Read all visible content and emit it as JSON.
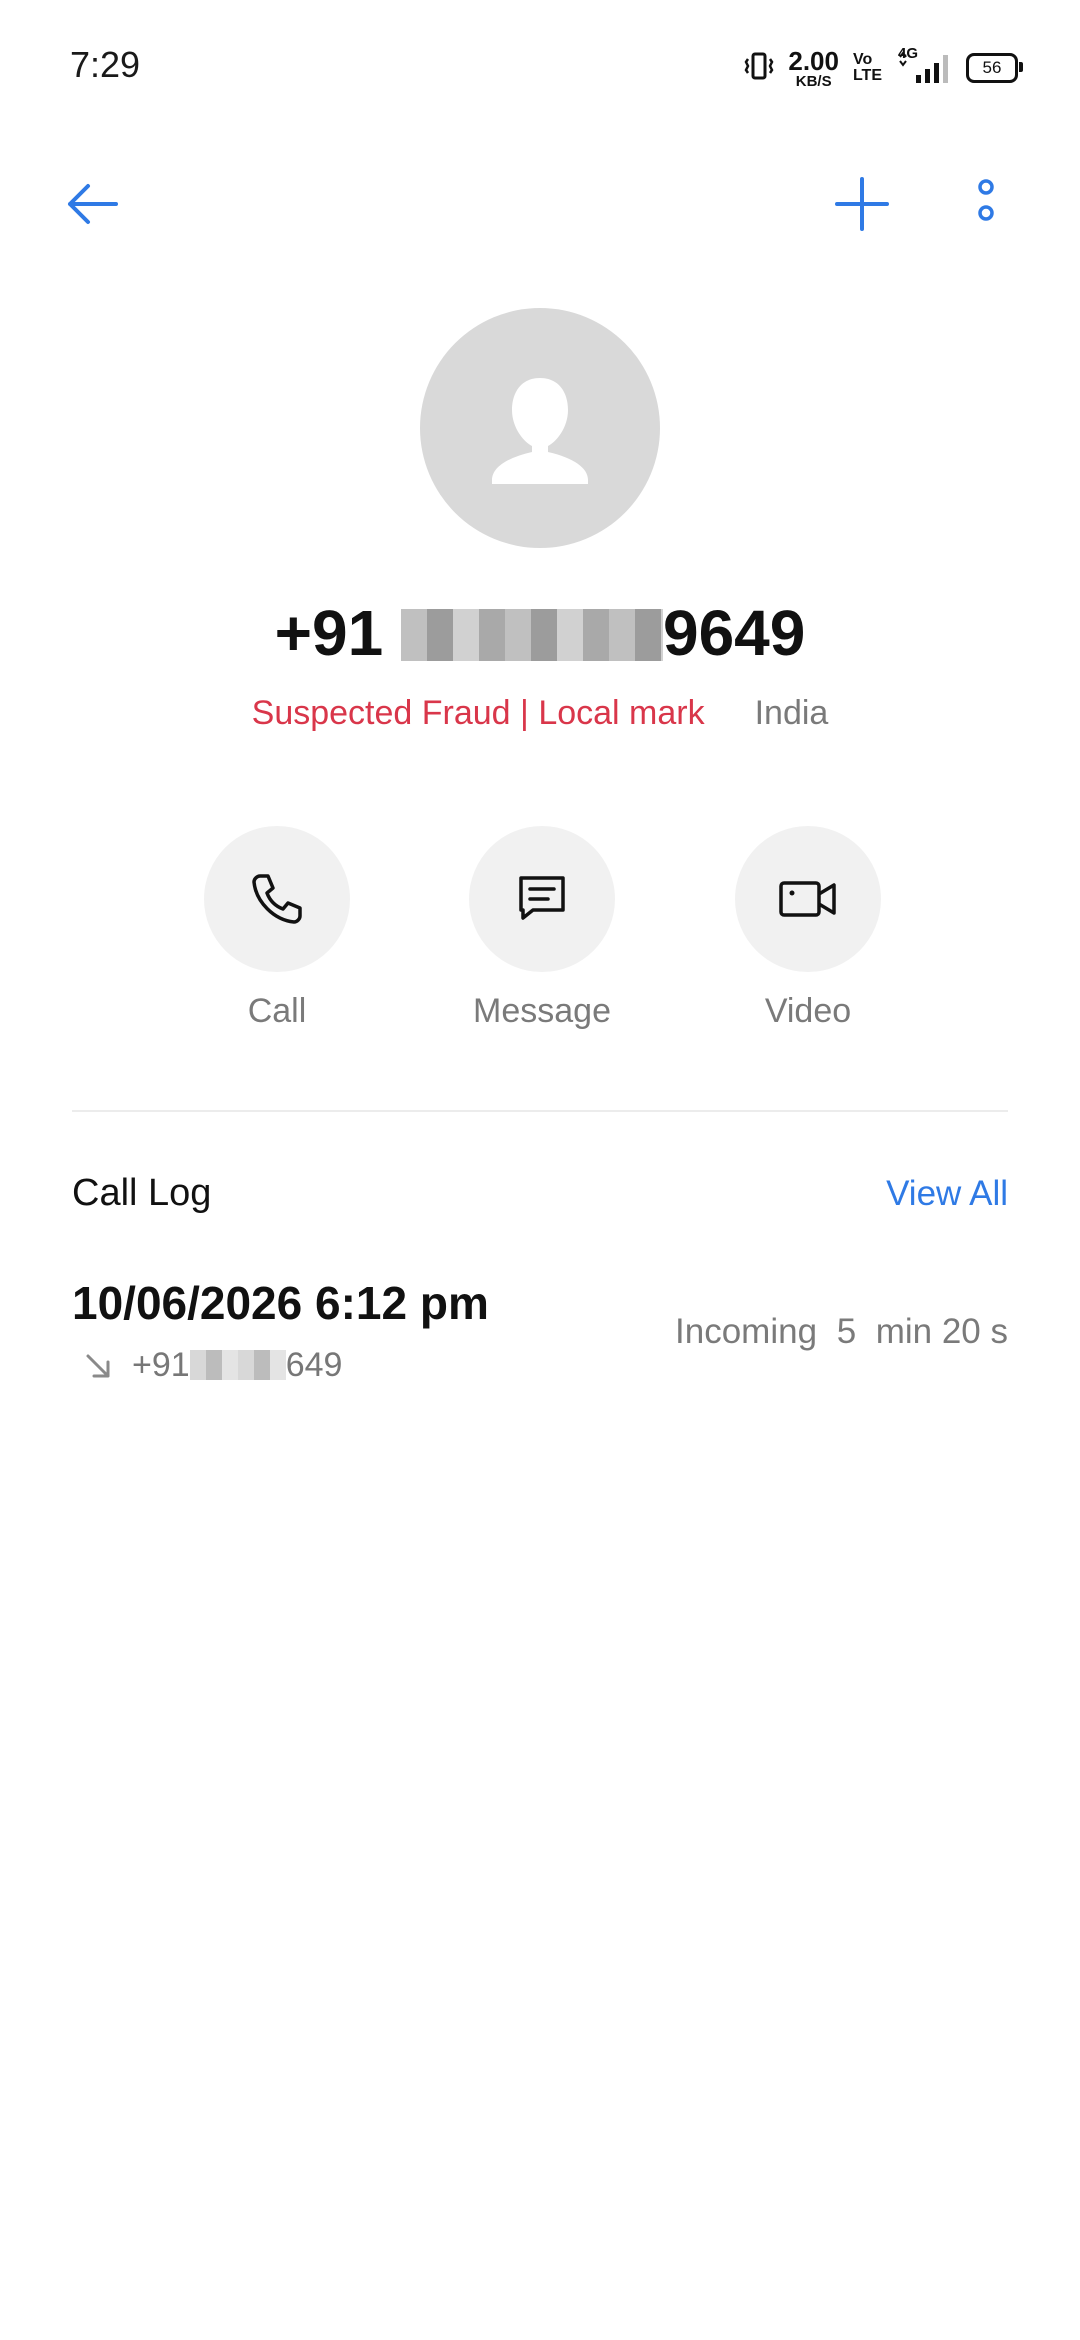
{
  "status_bar": {
    "time": "7:29",
    "net_speed_value": "2.00",
    "net_speed_unit": "KB/S",
    "volte_top": "Vo",
    "volte_bottom": "LTE",
    "network_type": "4G",
    "battery_level": "56"
  },
  "header": {
    "back_icon": "arrow-left-icon",
    "add_icon": "plus-icon",
    "more_icon": "more-vertical-icon",
    "accent_color": "#2f7ae5"
  },
  "contact": {
    "avatar_icon": "person-icon",
    "number_prefix": "+91",
    "number_suffix": "9649",
    "fraud_label": "Suspected Fraud | Local mark",
    "region": "India",
    "fraud_color": "#d9364a"
  },
  "actions": [
    {
      "label": "Call",
      "icon": "phone-icon"
    },
    {
      "label": "Message",
      "icon": "message-icon"
    },
    {
      "label": "Video",
      "icon": "video-camera-icon"
    }
  ],
  "call_log": {
    "title": "Call Log",
    "view_all": "View All",
    "entries": [
      {
        "datetime": "10/06/2026 6:12 pm",
        "direction_icon": "incoming-arrow-icon",
        "number_prefix": "+91",
        "number_suffix": "649",
        "type": "Incoming",
        "duration": "5  min 20 s"
      }
    ]
  }
}
